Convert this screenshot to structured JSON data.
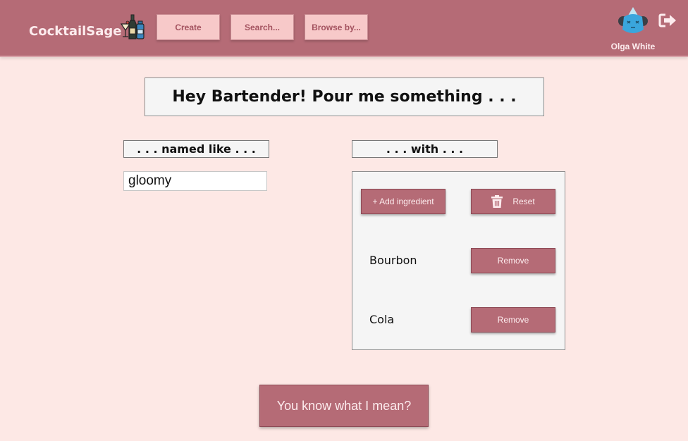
{
  "header": {
    "brand": "CocktailSage",
    "logo_icon": "cocktail-bottles-icon",
    "nav": {
      "create": "Create",
      "search": "Search...",
      "browse": "Browse by..."
    },
    "user": {
      "name": "Olga White",
      "avatar_icon": "blue-cat-avatar"
    },
    "logout_icon": "logout-icon"
  },
  "main": {
    "headline": "Hey Bartender! Pour me something . . .",
    "named_label": ". . . named like . . .",
    "name_value": "gloomy",
    "with_label": ". . . with . . .",
    "add_ingredient": "+ Add ingredient",
    "reset": "Reset",
    "ingredients": [
      {
        "name": "Bourbon",
        "remove": "Remove"
      },
      {
        "name": "Cola",
        "remove": "Remove"
      }
    ],
    "submit": "You know what I mean?"
  },
  "colors": {
    "header_bg": "#b56b76",
    "page_bg": "#fde8e5",
    "nav_button_bg": "#f7c9c9",
    "action_button_bg": "#b56b76"
  }
}
